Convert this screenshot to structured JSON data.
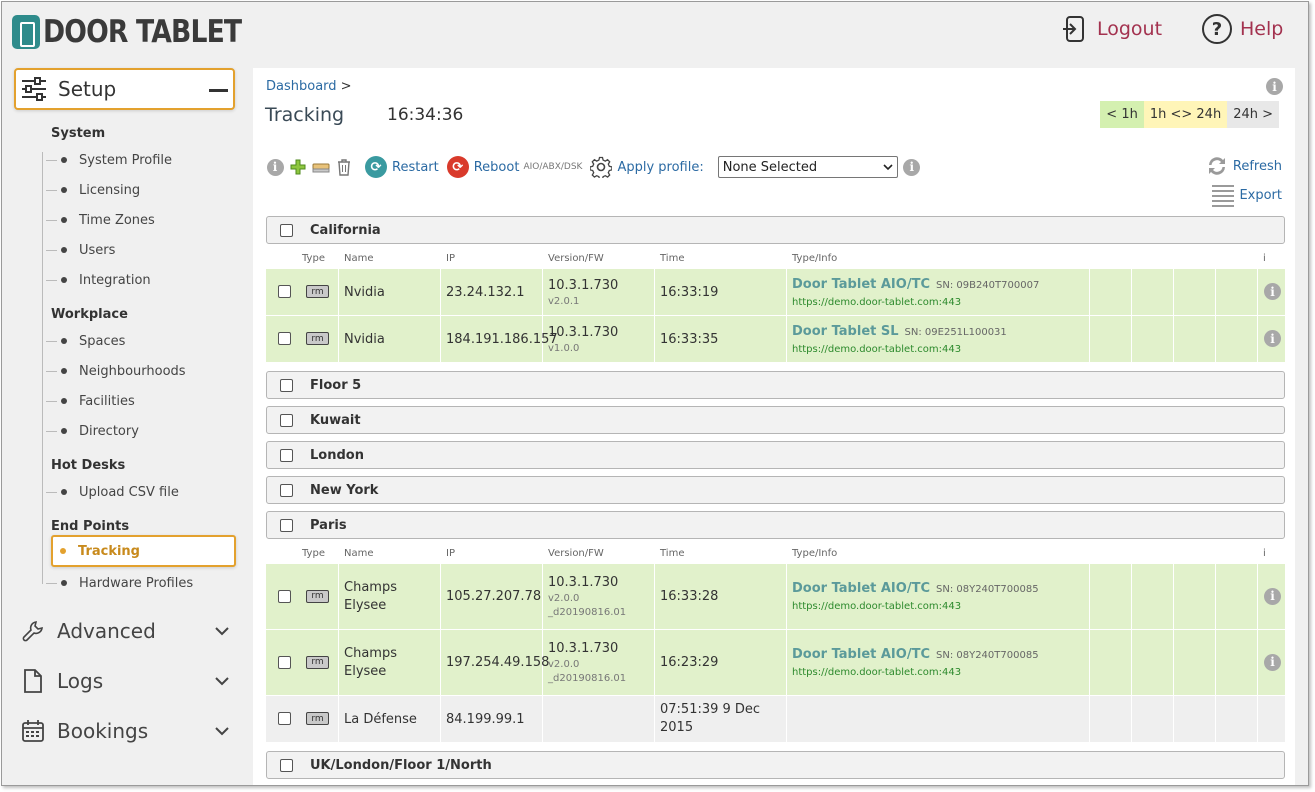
{
  "header": {
    "logo_text": "DOOR TABLET",
    "logout_label": "Logout",
    "help_label": "Help",
    "accent_color": "#a3324f"
  },
  "sidebar": {
    "setup_label": "Setup",
    "sections": [
      {
        "title": "System",
        "items": [
          "System Profile",
          "Licensing",
          "Time Zones",
          "Users",
          "Integration"
        ]
      },
      {
        "title": "Workplace",
        "items": [
          "Spaces",
          "Neighbourhoods",
          "Facilities",
          "Directory"
        ]
      },
      {
        "title": "Hot Desks",
        "items": [
          "Upload CSV file"
        ]
      },
      {
        "title": "End Points",
        "items": [
          "Tracking",
          "Hardware Profiles"
        ]
      }
    ],
    "active_item": "Tracking",
    "groups": [
      "Advanced",
      "Logs",
      "Bookings"
    ]
  },
  "main": {
    "breadcrumb": "Dashboard",
    "breadcrumb_sep": ">",
    "title": "Tracking",
    "clock": "16:34:36",
    "ranges": [
      "< 1h",
      "1h <> 24h",
      "24h >"
    ],
    "toolbar": {
      "restart_label": "Restart",
      "reboot_label": "Reboot",
      "reboot_sub": "AIO/ABX/DSK",
      "apply_profile_label": "Apply profile:",
      "profile_selected": "None Selected",
      "refresh_label": "Refresh",
      "export_label": "Export"
    },
    "columns": [
      "Type",
      "Name",
      "IP",
      "Version/FW",
      "Time",
      "Type/Info",
      "i"
    ],
    "locations": [
      {
        "name": "California",
        "devices": [
          {
            "type": "rm",
            "name": "Nvidia",
            "ip": "23.24.132.1",
            "version": "10.3.1.730",
            "fw": "v2.0.1",
            "time": "16:33:19",
            "model": "Door Tablet AIO/TC",
            "sn": "SN: 09B240T700007",
            "url": "https://demo.door-tablet.com:443"
          },
          {
            "type": "rm",
            "name": "Nvidia",
            "ip": "184.191.186.157",
            "version": "10.3.1.730",
            "fw": "v1.0.0",
            "time": "16:33:35",
            "model": "Door Tablet SL",
            "sn": "SN: 09E251L100031",
            "url": "https://demo.door-tablet.com:443"
          }
        ]
      },
      {
        "name": "Floor 5"
      },
      {
        "name": "Kuwait"
      },
      {
        "name": "London"
      },
      {
        "name": "New York"
      },
      {
        "name": "Paris",
        "devices": [
          {
            "type": "rm",
            "name": "Champs Elysee",
            "ip": "105.27.207.78",
            "version": "10.3.1.730",
            "fw": "v2.0.0",
            "fw2": "_d20190816.01",
            "time": "16:33:28",
            "model": "Door Tablet AIO/TC",
            "sn": "SN: 08Y240T700085",
            "url": "https://demo.door-tablet.com:443"
          },
          {
            "type": "rm",
            "name": "Champs Elysee",
            "ip": "197.254.49.158",
            "version": "10.3.1.730",
            "fw": "v2.0.0",
            "fw2": "_d20190816.01",
            "time": "16:23:29",
            "model": "Door Tablet AIO/TC",
            "sn": "SN: 08Y240T700085",
            "url": "https://demo.door-tablet.com:443"
          },
          {
            "type": "rm",
            "name": "La Défense",
            "ip": "84.199.99.1",
            "version": "",
            "fw": "",
            "time": "07:51:39 9 Dec 2015",
            "model": "",
            "sn": "",
            "url": ""
          }
        ]
      },
      {
        "name": "UK/London/Floor 1/North"
      }
    ],
    "colors": {
      "online_row": "#e1f1cb",
      "offline_row": "#efefef",
      "link": "#2b6aa3"
    }
  }
}
